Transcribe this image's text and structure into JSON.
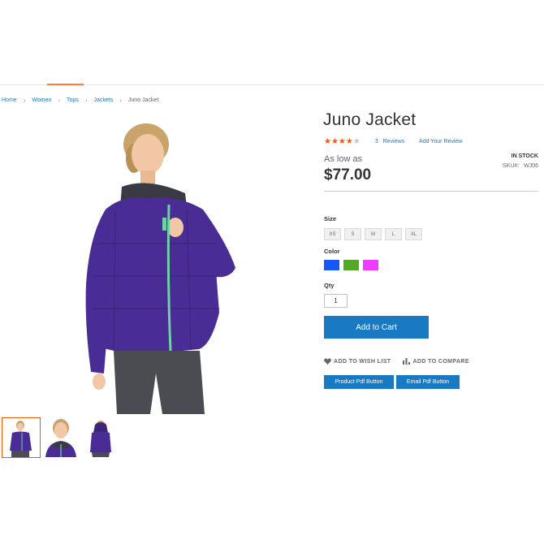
{
  "breadcrumb": {
    "items": [
      "Home",
      "Women",
      "Tops",
      "Jackets"
    ],
    "current": "Juno Jacket",
    "separator": "›"
  },
  "product": {
    "title": "Juno Jacket",
    "rating_stars": "★★★★★",
    "rating_value": 3.5,
    "reviews_count": "3",
    "reviews_label": "Reviews",
    "add_review": "Add Your Review",
    "as_low_as": "As low as",
    "price": "$77.00",
    "stock": "IN STOCK",
    "sku_label": "SKU#:",
    "sku_value": "WJ06"
  },
  "options": {
    "size_label": "Size",
    "sizes": [
      "XS",
      "S",
      "M",
      "L",
      "XL"
    ],
    "color_label": "Color",
    "colors": [
      "#1857f7",
      "#53a828",
      "#ef3dff"
    ],
    "color_icons": [
      "blue-swatch",
      "green-swatch",
      "purple-swatch"
    ],
    "qty_label": "Qty",
    "qty_value": "1"
  },
  "actions": {
    "add_to_cart": "Add to Cart",
    "wishlist": "ADD TO WISH LIST",
    "compare": "ADD TO COMPARE",
    "product_pdf": "Product Pdf Button",
    "email_pdf": "Email Pdf Button"
  },
  "gallery": {
    "main_image": "woman-purple-jacket-photo",
    "thumbnails": [
      "front-view",
      "close-up",
      "back-view"
    ]
  },
  "colors": {
    "accent": "#1979c3",
    "star": "#ff5501",
    "jacket": "#4a2d94"
  }
}
